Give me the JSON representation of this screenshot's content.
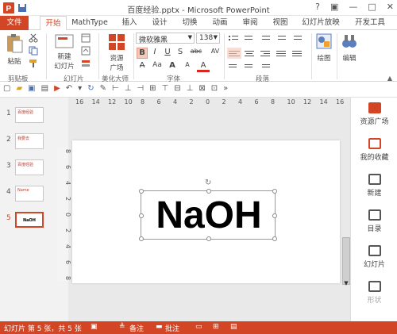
{
  "window": {
    "title": "百度经验.pptx - Microsoft PowerPoint",
    "help": "?",
    "min": "—",
    "max": "□",
    "close": "✕"
  },
  "tabs": {
    "file": "文件",
    "home": "开始",
    "mathtype": "MathType",
    "insert": "插入",
    "design": "设计",
    "transitions": "切换",
    "animations": "动画",
    "review": "审阅",
    "view": "视图",
    "slideshow": "幻灯片放映",
    "developer": "开发工具"
  },
  "ribbon": {
    "clipboard": {
      "paste": "粘贴",
      "label": "剪贴板"
    },
    "slides": {
      "new_slide_1": "新建",
      "new_slide_2": "幻灯片",
      "label": "幻灯片"
    },
    "beautify": {
      "btn1": "资源",
      "btn2": "广场",
      "label": "美化大师"
    },
    "font": {
      "name": "微软雅黑",
      "size": "138",
      "label": "字体",
      "bold": "B",
      "italic": "I",
      "underline": "U",
      "strike": "S",
      "shadow": "abc",
      "fontcolor": "A",
      "spacing": "AV",
      "grow": "A",
      "shrink": "A",
      "case": "Aa"
    },
    "paragraph": {
      "label": "段落"
    },
    "drawing": {
      "label": "绘图"
    },
    "editing": {
      "label": "编辑"
    }
  },
  "ruler_h": [
    "16",
    "14",
    "12",
    "10",
    "8",
    "6",
    "4",
    "2",
    "0",
    "2",
    "4",
    "6",
    "8",
    "10",
    "12",
    "14",
    "16"
  ],
  "ruler_v": [
    "8",
    "6",
    "4",
    "2",
    "0",
    "2",
    "4",
    "6",
    "8"
  ],
  "thumbnails": [
    {
      "num": "1",
      "text": "百度经验"
    },
    {
      "num": "2",
      "text": "我要去"
    },
    {
      "num": "3",
      "text": "百度经验"
    },
    {
      "num": "4",
      "text": "Name"
    },
    {
      "num": "5",
      "text": "NaOH"
    }
  ],
  "slide": {
    "text": "NaOH"
  },
  "rightpane": {
    "items": [
      "资源广场",
      "我的收藏",
      "新建",
      "目录",
      "幻灯片",
      "形状"
    ]
  },
  "status": {
    "slide_info": "幻灯片 第 5 张，共 5 张",
    "notes": "备注",
    "comments": "批注"
  },
  "colors": {
    "accent": "#d24625"
  }
}
